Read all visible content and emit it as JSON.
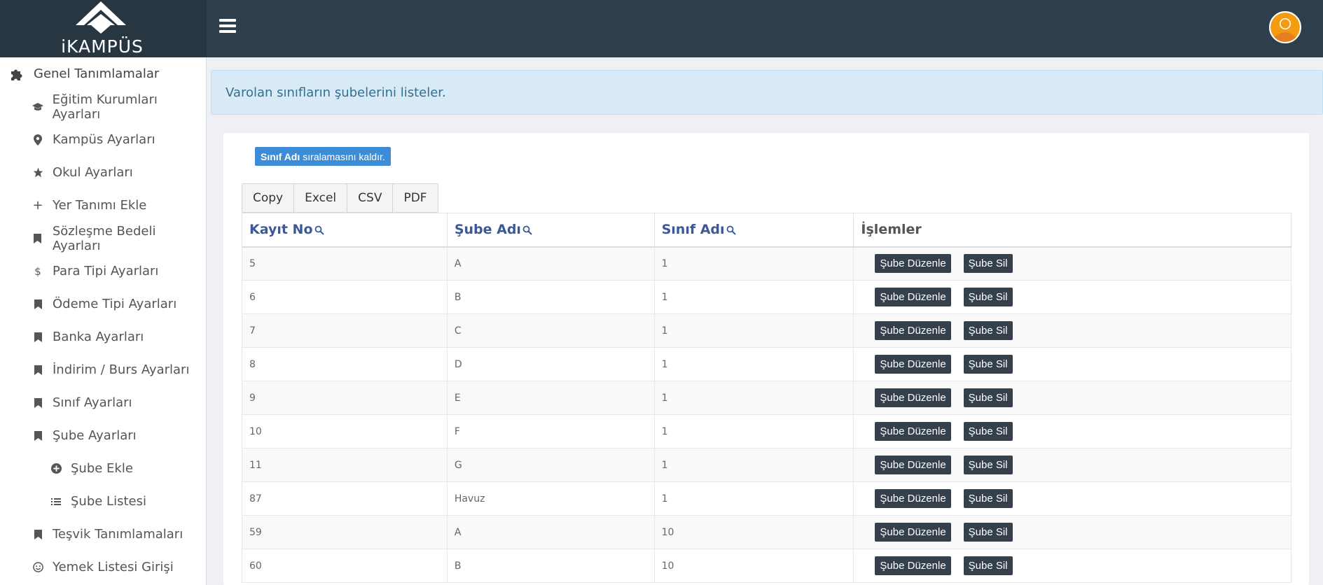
{
  "brand": {
    "logo_text": "iKAMPÜS"
  },
  "sidebar": {
    "section_title": "Genel Tanımlamalar",
    "items": [
      {
        "label": "Eğitim Kurumları Ayarları",
        "icon": "graduation-cap-icon"
      },
      {
        "label": "Kampüs Ayarları",
        "icon": "map-pin-icon"
      },
      {
        "label": "Okul Ayarları",
        "icon": "star-icon"
      },
      {
        "label": "Yer Tanımı Ekle",
        "icon": "plus-icon"
      },
      {
        "label": "Sözleşme Bedeli Ayarları",
        "icon": "bookmark-icon"
      },
      {
        "label": "Para Tipi Ayarları",
        "icon": "dollar-icon"
      },
      {
        "label": "Ödeme Tipi Ayarları",
        "icon": "bookmark-icon"
      },
      {
        "label": "Banka Ayarları",
        "icon": "bookmark-icon"
      },
      {
        "label": "İndirim / Burs Ayarları",
        "icon": "bookmark-icon"
      },
      {
        "label": "Sınıf Ayarları",
        "icon": "bookmark-icon"
      },
      {
        "label": "Şube Ayarları",
        "icon": "bookmark-icon"
      }
    ],
    "sub_items": [
      {
        "label": "Şube Ekle",
        "icon": "plus-circle-icon"
      },
      {
        "label": "Şube Listesi",
        "icon": "list-icon"
      }
    ],
    "items_after": [
      {
        "label": "Teşvik Tanımlamaları",
        "icon": "bookmark-icon"
      },
      {
        "label": "Yemek Listesi Girişi",
        "icon": "smile-icon"
      }
    ]
  },
  "main": {
    "info_text": "Varolan sınıfların şubelerini listeler.",
    "sort_button": {
      "bold": "Sınıf Adı",
      "rest": "sıralamasını kaldır."
    },
    "export_buttons": [
      "Copy",
      "Excel",
      "CSV",
      "PDF"
    ],
    "table": {
      "headers": [
        "Kayıt No",
        "Şube Adı",
        "Sınıf Adı",
        "İşlemler"
      ],
      "edit_label": "Şube Düzenle",
      "delete_label": "Şube Sil",
      "rows": [
        {
          "id": "5",
          "sube": "A",
          "sinif": "1"
        },
        {
          "id": "6",
          "sube": "B",
          "sinif": "1"
        },
        {
          "id": "7",
          "sube": "C",
          "sinif": "1"
        },
        {
          "id": "8",
          "sube": "D",
          "sinif": "1"
        },
        {
          "id": "9",
          "sube": "E",
          "sinif": "1"
        },
        {
          "id": "10",
          "sube": "F",
          "sinif": "1"
        },
        {
          "id": "11",
          "sube": "G",
          "sinif": "1"
        },
        {
          "id": "87",
          "sube": "Havuz",
          "sinif": "1"
        },
        {
          "id": "59",
          "sube": "A",
          "sinif": "10"
        },
        {
          "id": "60",
          "sube": "B",
          "sinif": "10"
        }
      ]
    }
  },
  "colors": {
    "topbar": "#2f3e4b",
    "link_header": "#3b5998",
    "action_button": "#34414d",
    "sort_button": "#3d8dd6",
    "info_bg": "#d9eaf7",
    "avatar": "#f39c12"
  }
}
